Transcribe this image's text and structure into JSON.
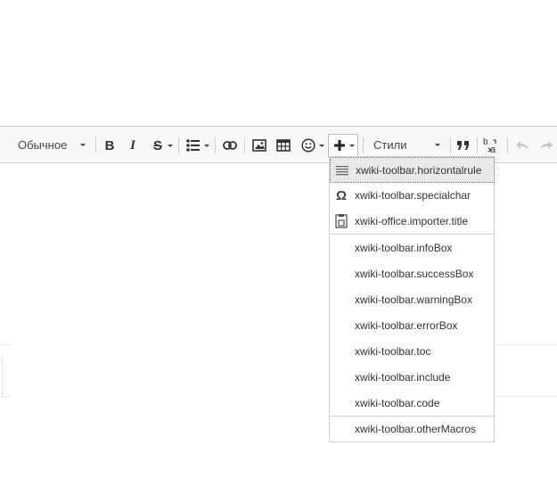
{
  "toolbar": {
    "format_combo": "Обычное",
    "styles_combo": "Стили",
    "bold_label": "B",
    "italic_label": "I",
    "strike_label": "S",
    "buttons": [
      {
        "icon": "bulleted-list-icon"
      },
      {
        "icon": "link-icon"
      },
      {
        "icon": "image-icon"
      },
      {
        "icon": "table-icon"
      },
      {
        "icon": "smiley-icon"
      },
      {
        "icon": "plus-icon"
      },
      {
        "icon": "blockquote-icon"
      },
      {
        "icon": "language-icon"
      },
      {
        "icon": "undo-icon"
      },
      {
        "icon": "redo-icon"
      }
    ]
  },
  "menu": {
    "group1": [
      {
        "label": "xwiki-toolbar.horizontalrule",
        "icon": "horizontal-rule-icon",
        "highlighted": true
      },
      {
        "label": "xwiki-toolbar.specialchar",
        "icon": "omega-icon"
      },
      {
        "label": "xwiki-office.importer.title",
        "icon": "office-import-icon"
      }
    ],
    "group2": [
      {
        "label": "xwiki-toolbar.infoBox"
      },
      {
        "label": "xwiki-toolbar.successBox"
      },
      {
        "label": "xwiki-toolbar.warningBox"
      },
      {
        "label": "xwiki-toolbar.errorBox"
      },
      {
        "label": "xwiki-toolbar.toc"
      },
      {
        "label": "xwiki-toolbar.include"
      },
      {
        "label": "xwiki-toolbar.code"
      }
    ],
    "group3": [
      {
        "label": "xwiki-toolbar.otherMacros"
      }
    ]
  }
}
